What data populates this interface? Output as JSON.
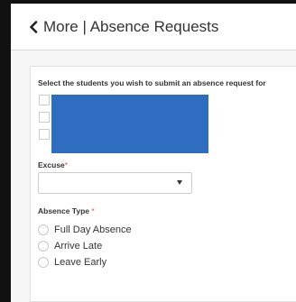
{
  "header": {
    "back_label": "More",
    "separator": "|",
    "title": "Absence Requests"
  },
  "form": {
    "students_prompt": "Select the students you wish to submit an absence request for",
    "excuse": {
      "label": "Excuse",
      "required_mark": "*",
      "selected_value": ""
    },
    "absence_type": {
      "label": "Absence Type",
      "required_mark": "*",
      "options": [
        {
          "label": "Full Day Absence"
        },
        {
          "label": "Arrive Late"
        },
        {
          "label": "Leave Early"
        }
      ]
    }
  },
  "colors": {
    "redaction_block": "#2e6dbf",
    "required_mark": "#d9534f"
  },
  "icons": {
    "back": "chevron-left-icon",
    "dropdown": "caret-down-icon"
  }
}
